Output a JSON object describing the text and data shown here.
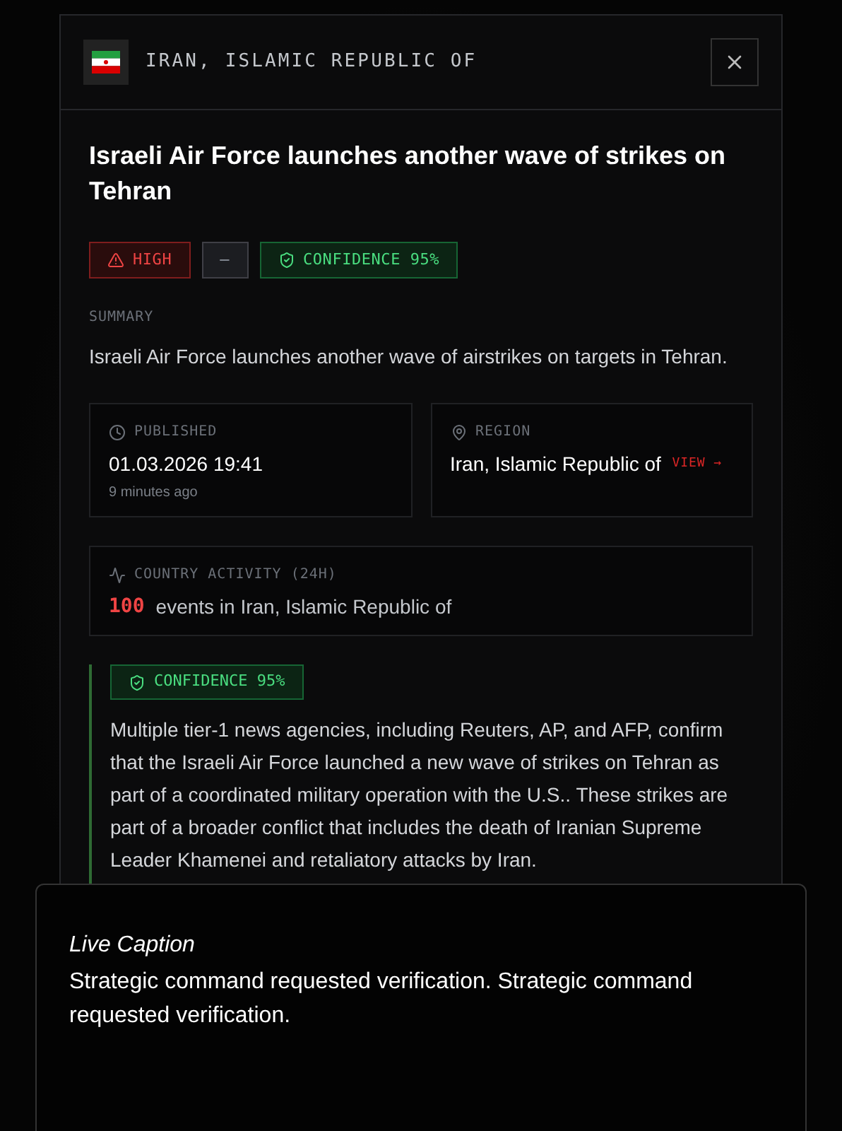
{
  "header": {
    "country": "IRAN, ISLAMIC REPUBLIC OF"
  },
  "title": "Israeli Air Force launches another wave of strikes on Tehran",
  "badges": [
    {
      "kind": "severity",
      "label": "HIGH"
    },
    {
      "kind": "neutral",
      "label": "—"
    },
    {
      "kind": "confidence",
      "label": "CONFIDENCE 95%"
    }
  ],
  "summary": {
    "label": "SUMMARY",
    "text": "Israeli Air Force launches another wave of airstrikes on targets in Tehran."
  },
  "published": {
    "label": "PUBLISHED",
    "value": "01.03.2026 19:41",
    "relative": "9 minutes ago"
  },
  "region": {
    "label": "REGION",
    "value": "Iran, Islamic Republic of",
    "link": "VIEW →"
  },
  "activity": {
    "label": "COUNTRY ACTIVITY (24H)",
    "count": "100",
    "text": "events in Iran, Islamic Republic of"
  },
  "assessment": {
    "badge": "CONFIDENCE 95%",
    "text": "Multiple tier-1 news agencies, including Reuters, AP, and AFP, confirm that the Israeli Air Force launched a new wave of strikes on Tehran as part of a coordinated military operation with the U.S.. These strikes are part of a broader conflict that includes the death of Iranian Supreme Leader Khamenei and retaliatory attacks by Iran."
  },
  "caption": {
    "title": "Live Caption",
    "text": "Strategic command requested verification. Strategic command requested verification."
  }
}
